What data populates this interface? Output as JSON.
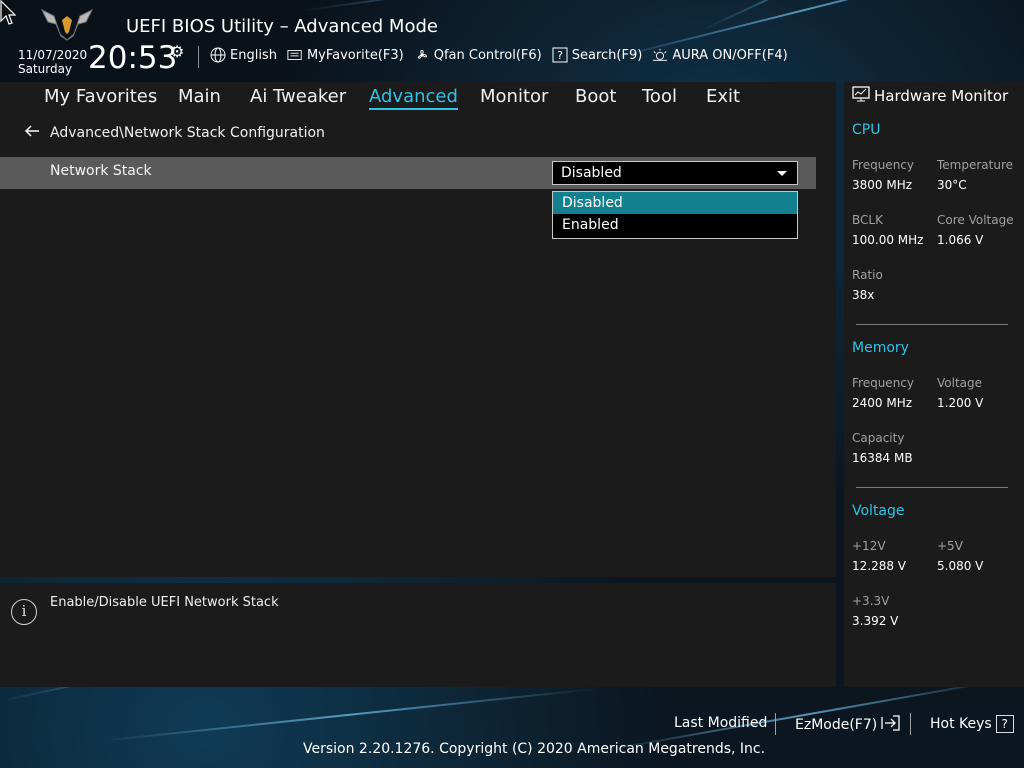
{
  "header": {
    "title": "UEFI BIOS Utility – Advanced Mode",
    "date": "11/07/2020",
    "day": "Saturday",
    "time": "20:53",
    "toolbar": [
      {
        "label": "English",
        "icon": "globe-icon"
      },
      {
        "label": "MyFavorite(F3)",
        "icon": "favorite-icon"
      },
      {
        "label": "Qfan Control(F6)",
        "icon": "fan-icon"
      },
      {
        "label": "Search(F9)",
        "icon": "search-icon"
      },
      {
        "label": "AURA ON/OFF(F4)",
        "icon": "aura-icon"
      }
    ]
  },
  "tabs": [
    {
      "label": "My Favorites"
    },
    {
      "label": "Main"
    },
    {
      "label": "Ai Tweaker"
    },
    {
      "label": "Advanced",
      "active": true
    },
    {
      "label": "Monitor"
    },
    {
      "label": "Boot"
    },
    {
      "label": "Tool"
    },
    {
      "label": "Exit"
    }
  ],
  "breadcrumb": "Advanced\\Network Stack Configuration",
  "setting": {
    "label": "Network Stack",
    "value": "Disabled",
    "options": [
      "Disabled",
      "Enabled"
    ],
    "selected_option": "Disabled"
  },
  "help": {
    "text": "Enable/Disable UEFI Network Stack"
  },
  "hardware_monitor": {
    "title": "Hardware Monitor",
    "cpu": {
      "title": "CPU",
      "frequency_label": "Frequency",
      "frequency": "3800 MHz",
      "temperature_label": "Temperature",
      "temperature": "30°C",
      "bclk_label": "BCLK",
      "bclk": "100.00 MHz",
      "core_voltage_label": "Core Voltage",
      "core_voltage": "1.066 V",
      "ratio_label": "Ratio",
      "ratio": "38x"
    },
    "memory": {
      "title": "Memory",
      "frequency_label": "Frequency",
      "frequency": "2400 MHz",
      "voltage_label": "Voltage",
      "voltage": "1.200 V",
      "capacity_label": "Capacity",
      "capacity": "16384 MB"
    },
    "voltage": {
      "title": "Voltage",
      "v12_label": "+12V",
      "v12": "12.288 V",
      "v5_label": "+5V",
      "v5": "5.080 V",
      "v33_label": "+3.3V",
      "v33": "3.392 V"
    }
  },
  "footer": {
    "last_modified": "Last Modified",
    "ezmode": "EzMode(F7)",
    "hotkeys": "Hot Keys",
    "hotkeys_icon_text": "?",
    "copyright": "Version 2.20.1276. Copyright (C) 2020 American Megatrends, Inc."
  },
  "colors": {
    "accent": "#2fc3e6",
    "panel": "#1b1b1b",
    "selected_row": "#5a5a5a",
    "selected_option": "#13808f"
  }
}
